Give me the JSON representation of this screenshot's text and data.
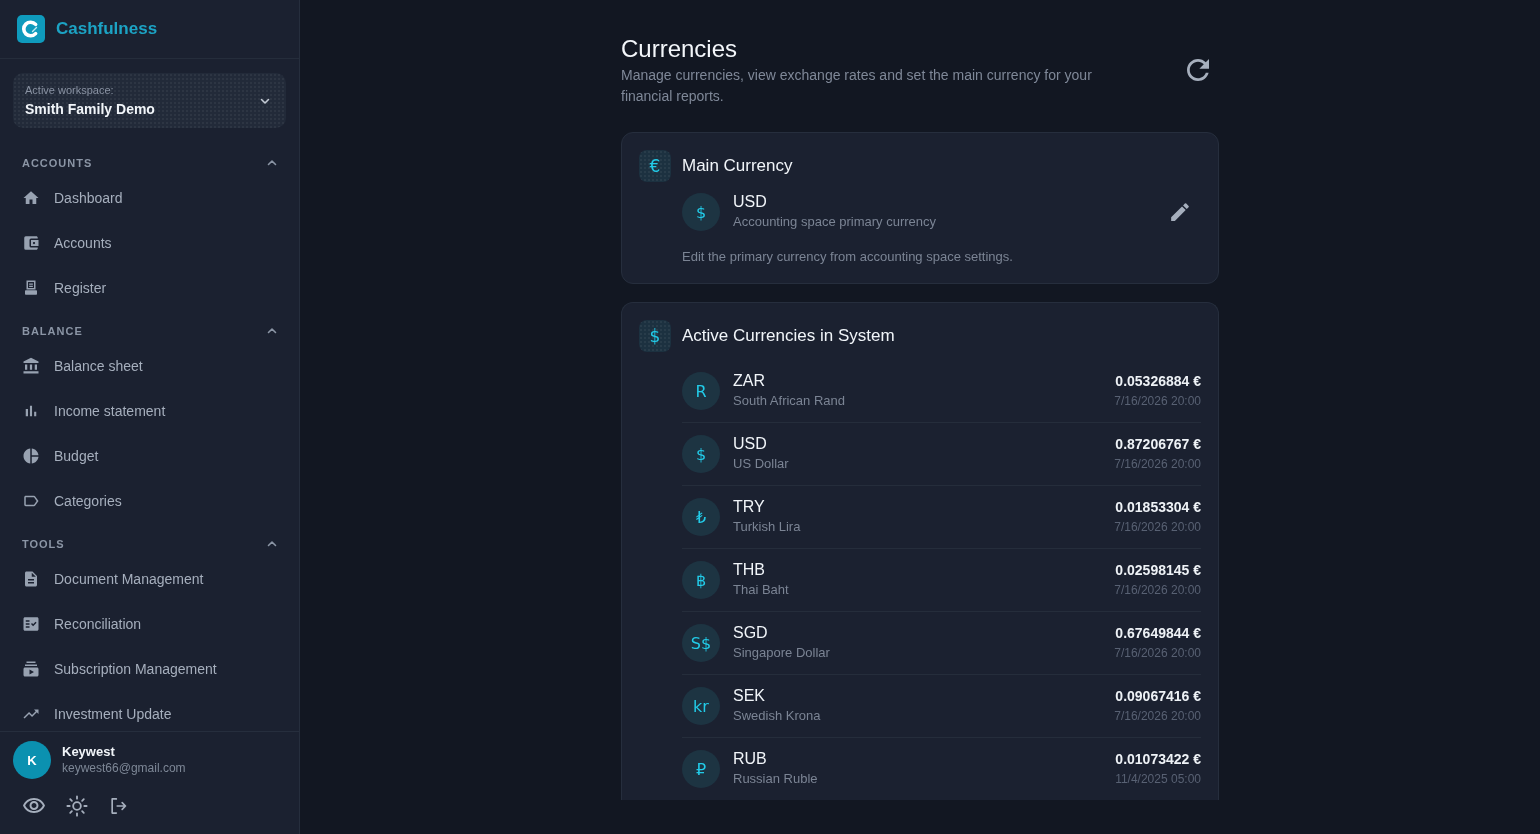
{
  "sidebar": {
    "brand": "Cashfulness",
    "workspace": {
      "label": "Active workspace:",
      "name": "Smith Family Demo"
    },
    "sections": [
      {
        "title": "ACCOUNTS",
        "expanded": true,
        "items": [
          {
            "label": "Dashboard",
            "selected": false
          },
          {
            "label": "Accounts",
            "selected": false
          },
          {
            "label": "Register",
            "selected": false
          }
        ]
      },
      {
        "title": "BALANCE",
        "expanded": true,
        "items": [
          {
            "label": "Balance sheet",
            "selected": false
          },
          {
            "label": "Income statement",
            "selected": false
          },
          {
            "label": "Budget",
            "selected": false
          },
          {
            "label": "Categories",
            "selected": false
          }
        ]
      },
      {
        "title": "TOOLS",
        "expanded": true,
        "items": [
          {
            "label": "Document Management",
            "selected": false
          },
          {
            "label": "Reconciliation",
            "selected": false
          },
          {
            "label": "Subscription Management",
            "selected": false
          },
          {
            "label": "Investment Update",
            "selected": false
          }
        ]
      }
    ],
    "user": {
      "initial": "K",
      "name": "Keywest",
      "email": "keywest66@gmail.com"
    }
  },
  "page": {
    "title": "Currencies",
    "description": "Manage currencies, view exchange rates and set the main currency for your financial reports."
  },
  "main_currency": {
    "symbol": "€",
    "title": "Main Currency",
    "currency": {
      "symbol": "$",
      "code": "USD",
      "caption": "Accounting space primary currency"
    },
    "note": "Edit the primary currency from accounting space settings."
  },
  "active_currencies": {
    "symbol": "$",
    "title": "Active Currencies in System",
    "rows": [
      {
        "symbol": "R",
        "code": "ZAR",
        "name": "South African Rand",
        "rate": "0.05326884 €",
        "updated": "7/16/2026 20:00"
      },
      {
        "symbol": "$",
        "code": "USD",
        "name": "US Dollar",
        "rate": "0.87206767 €",
        "updated": "7/16/2026 20:00"
      },
      {
        "symbol": "₺",
        "code": "TRY",
        "name": "Turkish Lira",
        "rate": "0.01853304 €",
        "updated": "7/16/2026 20:00"
      },
      {
        "symbol": "฿",
        "code": "THB",
        "name": "Thai Baht",
        "rate": "0.02598145 €",
        "updated": "7/16/2026 20:00"
      },
      {
        "symbol": "S$",
        "code": "SGD",
        "name": "Singapore Dollar",
        "rate": "0.67649844 €",
        "updated": "7/16/2026 20:00"
      },
      {
        "symbol": "kr",
        "code": "SEK",
        "name": "Swedish Krona",
        "rate": "0.09067416 €",
        "updated": "7/16/2026 20:00"
      },
      {
        "symbol": "₽",
        "code": "RUB",
        "name": "Russian Ruble",
        "rate": "0.01073422 €",
        "updated": "11/4/2025 05:00"
      }
    ]
  }
}
